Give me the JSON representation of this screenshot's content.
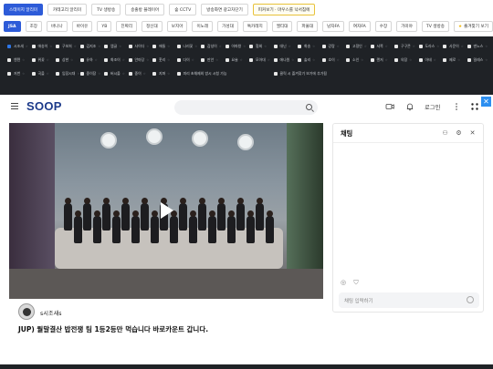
{
  "row1": [
    "스테이지 알리미",
    "카테고리 알리미",
    "TV 생방송",
    "송출방 플레이어",
    "숲 CCTV",
    "방송화면 광고차단기",
    "피커보기 · 마우스를 낙서침에"
  ],
  "row2": [
    "JSA",
    "조장",
    "바나나",
    "바이유",
    "YB",
    "진짜리",
    "정신대",
    "보지아",
    "이노래",
    "가성대",
    "톡카레지",
    "엘티대",
    "파울대",
    "남자FA",
    "여자FA",
    "수장",
    "가미야",
    "TV 생방송",
    "즐겨찾기 보기"
  ],
  "grid": [
    "시조새",
    "애송이",
    "구보처",
    "김지조",
    "엠글",
    "사이다",
    "애들",
    "나리꽃",
    "감성이",
    "아파왕",
    "협회",
    "대닌",
    "화송",
    "강랑",
    "고정인",
    "서쪽",
    "구구콘",
    "도라스",
    "사운이",
    "덴노스",
    "엔텐",
    "위꽃",
    "상한",
    "유하",
    "화조이",
    "안마당",
    "훗리",
    "다이",
    "판안",
    "요술",
    "모아대",
    "애나원",
    "솔리",
    "호이",
    "소인",
    "랜저",
    "의장",
    "아테",
    "제로",
    "밀레스",
    "저번",
    "곡을",
    "임장시대",
    "중이장",
    "버시올",
    "중이",
    "지퍼",
    "피리 초채제외 방시 시청 가능",
    "클릭 시 즐겨찾기 보기에 추가됨"
  ],
  "grid_checked": [
    0
  ],
  "header": {
    "logo": "SOOP",
    "login": "로그인"
  },
  "video": {
    "streamer": "s시조새s",
    "title": "JUP) 월말결산 밥전쟁 팀 1등2등만 먹습니다 바로카운트 갑니다."
  },
  "chat": {
    "title": "채팅",
    "placeholder": "채팅 입력하기"
  },
  "colors": {
    "accent": "#2d5bd8",
    "panel": "#1f2226"
  }
}
